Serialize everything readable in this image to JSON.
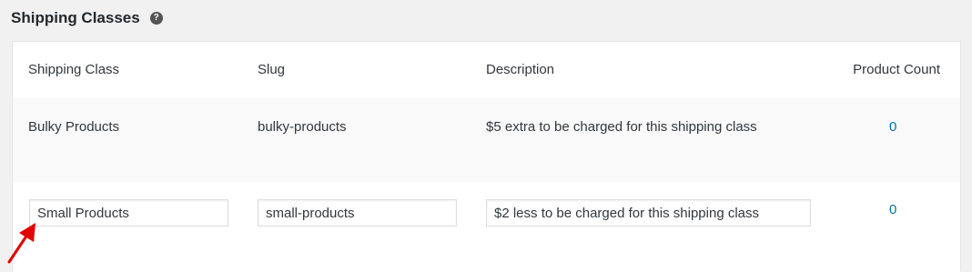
{
  "page": {
    "title": "Shipping Classes",
    "help_icon": "question-circle-icon",
    "help_glyph": "?"
  },
  "table": {
    "columns": [
      "Shipping Class",
      "Slug",
      "Description",
      "Product Count"
    ],
    "rows": [
      {
        "name": "Bulky Products",
        "slug": "bulky-products",
        "description": "$5 extra to be charged for this shipping class",
        "count": "0"
      },
      {
        "name": "Small Products",
        "slug": "small-products",
        "description": "$2 less to be charged for this shipping class",
        "count": "0",
        "editing": true
      }
    ]
  },
  "annotation": {
    "icon": "red-arrow-icon",
    "color": "#e00000"
  },
  "colors": {
    "link": "#0073aa",
    "page_background": "#f1f1f1"
  }
}
